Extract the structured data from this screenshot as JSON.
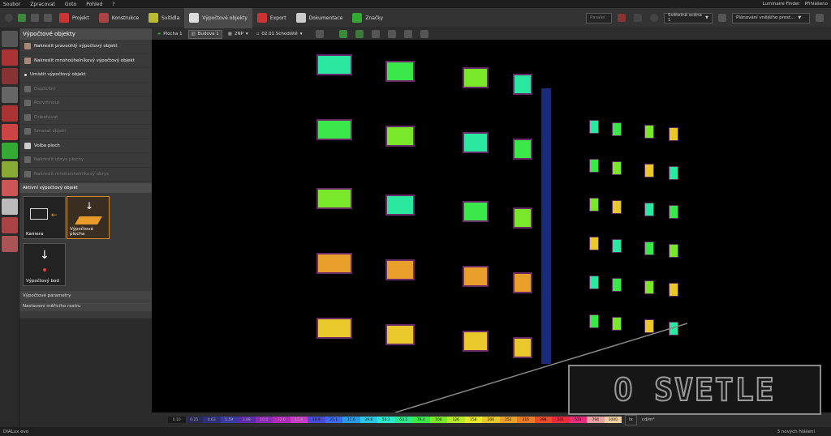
{
  "menu": [
    "Soubor",
    "Zpracovat",
    "Goto",
    "Pohled",
    "?"
  ],
  "topright": {
    "finder": "Luminaire Finder",
    "login": "Přihlášeno"
  },
  "toolbar": {
    "tabs": [
      "Projekt",
      "Konstrukce",
      "Svítidla",
      "Výpočtové objekty",
      "Export",
      "Dokumentace",
      "Značky"
    ],
    "active_tab": "Výpočtové objekty",
    "combo_light_scene": "Světelná scéna 1",
    "combo_planning": "Plánování vnějšího prost...",
    "combo_left": "Paralel"
  },
  "panel": {
    "title": "Výpočtové objekty",
    "items": [
      {
        "label": "Nakreslit pravoúhlý výpočtový objekt",
        "enabled": true
      },
      {
        "label": "Nakreslit mnohoúhelníkový výpočtový objekt",
        "enabled": true
      },
      {
        "label": "Umístit výpočtový objekt",
        "enabled": true
      },
      {
        "label": "Duplicitní",
        "enabled": false
      },
      {
        "label": "Rozvrhnout",
        "enabled": false
      },
      {
        "label": "Orientovat",
        "enabled": false
      },
      {
        "label": "Smazat objekt",
        "enabled": false
      },
      {
        "label": "Volba ploch",
        "enabled": true
      },
      {
        "label": "Nakreslit obrys plochy",
        "enabled": false
      },
      {
        "label": "Nakreslit mnohoúhelníkový obrys",
        "enabled": false
      }
    ],
    "section_active": "Aktivní výpočtový objekt",
    "tiles": [
      "Kamera",
      "Výpočtová plocha",
      "Výpočtový bod"
    ],
    "collapse1": "Výpočtové parametry",
    "collapse2": "Nastavení měřicího rastru"
  },
  "viewport_toolbar": {
    "plocha": "Plocha 1",
    "budova": "Budova 1",
    "floor": "2NP",
    "room": "02.01 Schodiště"
  },
  "legend": {
    "values": [
      "0.10",
      "0.25",
      "0.63",
      "1.59",
      "3.98",
      "10.0",
      "12.6",
      "15.8",
      "19.9",
      "25.1",
      "31.6",
      "39.8",
      "50.1",
      "63.1",
      "79.4",
      "100",
      "126",
      "158",
      "200",
      "251",
      "316",
      "398",
      "501",
      "631",
      "794",
      "1000"
    ],
    "colors": [
      "#1a1a1a",
      "#2a2a55",
      "#2e2e7a",
      "#3a3aa0",
      "#5a2aa8",
      "#8a2ab0",
      "#b02ab8",
      "#c83ac8",
      "#4a4ad8",
      "#3a6ae8",
      "#2a9ae8",
      "#2ac8e8",
      "#2ae8c8",
      "#2ae88a",
      "#3ae84a",
      "#7ae82a",
      "#b8e82a",
      "#e8e82a",
      "#e8c82a",
      "#e8a02a",
      "#e87a2a",
      "#e84a2a",
      "#e82a3a",
      "#e82a7a",
      "#e8a0a0",
      "#f0d0a0"
    ],
    "unit": "lx",
    "unit_label": "cd/m²"
  },
  "status": {
    "app": "DIALux evo",
    "messages": "3 nových hlášení"
  },
  "watermark": "O SVETLE"
}
